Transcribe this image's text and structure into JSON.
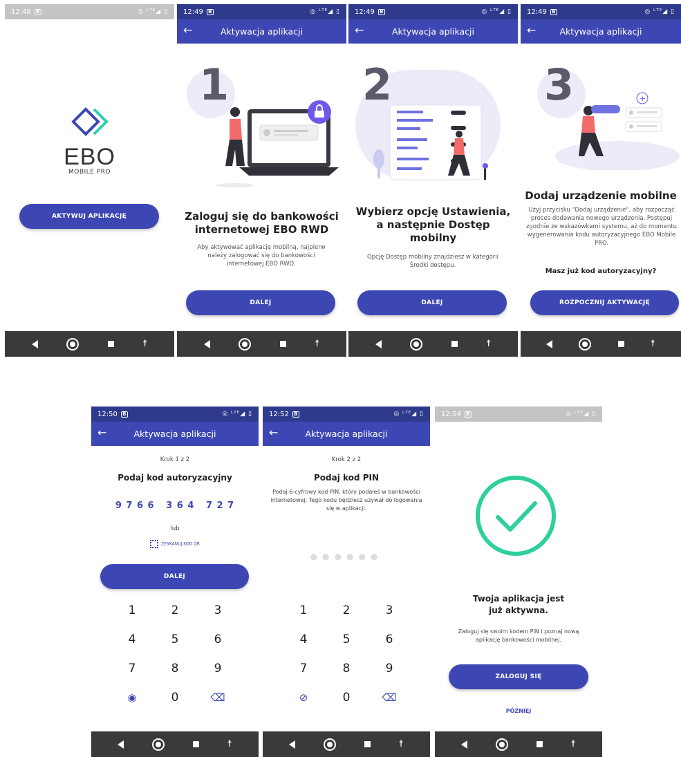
{
  "s1": {
    "time": "12:48",
    "logo_big": "EBO",
    "logo_small": "MOBILE PRO",
    "button": "AKTYWUJ APLIKACJĘ"
  },
  "appbar_title": "Aktywacja aplikacji",
  "s2": {
    "time": "12:49",
    "step": "1",
    "heading": "Zaloguj się do bankowości internetowej EBO RWD",
    "text": "Aby aktywować aplikację mobilną, najpierw należy zalogować się do bankowości internetowej EBO RWD.",
    "button": "DALEJ"
  },
  "s3": {
    "time": "12:49",
    "step": "2",
    "heading": "Wybierz opcję Ustawienia, a następnie Dostęp mobilny",
    "text": "Opcję Dostęp mobilny znajdziesz w kategorii Środki dostępu.",
    "button": "DALEJ"
  },
  "s4": {
    "time": "12:49",
    "step": "3",
    "heading": "Dodaj urządzenie mobilne",
    "text": "Użyj przycisku \"Dodaj urządzenie\", aby rozpocząć proces dodawania nowego urządzenia. Postępuj zgodnie ze wskazówkami systemu, aż do momentu wygenerowania kodu autoryzacyjnego EBO Mobile PRO.",
    "question": "Masz już kod autoryzacyjny?",
    "button": "ROZPOCZNIJ AKTYWACJĘ"
  },
  "s5": {
    "time": "12:50",
    "step_label": "Krok 1 z 2",
    "heading": "Podaj kod autoryzacyjny",
    "code": "9 7 6 6   3 6 4   7 2 7",
    "or": "lub",
    "scan": "ZESKANUJ KOD QR",
    "button": "DALEJ"
  },
  "s6": {
    "time": "12:52",
    "step_label": "Krok 2 z 2",
    "heading": "Podaj kod PIN",
    "text": "Podaj 6-cyfrowy kod PIN, który podałeś w bankowości internetowej. Tego kodu będziesz używał do logowania się w aplikacji."
  },
  "s7": {
    "time": "12:54",
    "heading": "Twoja aplikacja jest już aktywna.",
    "text": "Zaloguj się swoim kodem PIN i poznaj nową aplikację bankowości mobilnej.",
    "button": "ZALOGUJ SIĘ",
    "later": "PÓŹNIEJ"
  },
  "keys": [
    "1",
    "2",
    "3",
    "4",
    "5",
    "6",
    "7",
    "8",
    "9",
    "0"
  ],
  "colors": {
    "primary": "#3d47b3",
    "statusbar": "#2e3a8c",
    "success": "#2ecf9b",
    "navbar": "#3a3a3a",
    "illustration_red": "#f26b6b"
  }
}
